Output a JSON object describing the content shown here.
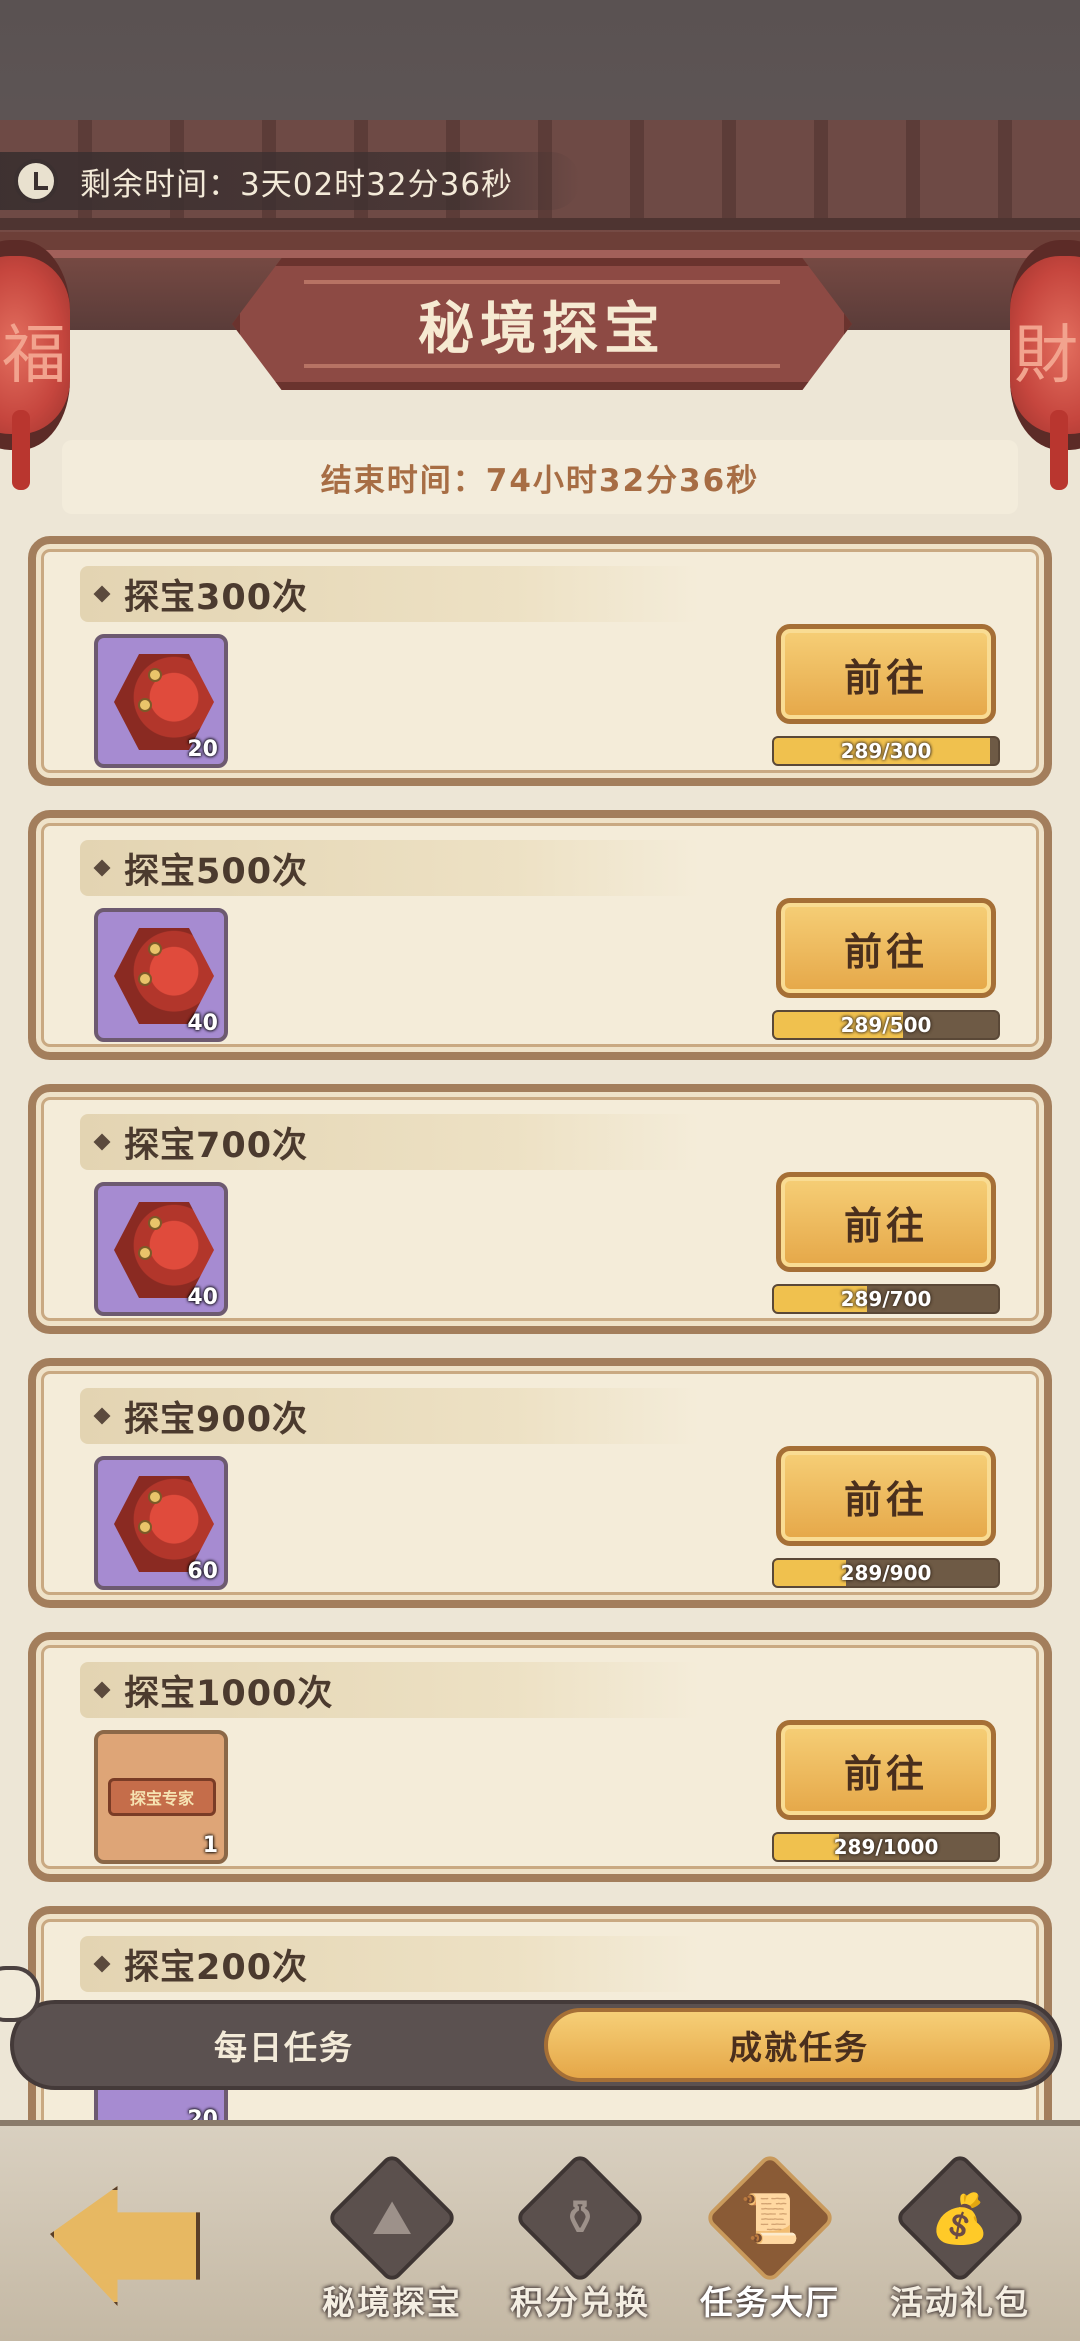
{
  "timer": {
    "label": "剩余时间：3天02时32分36秒"
  },
  "lanterns": {
    "left_glyph": "福",
    "right_glyph": "財"
  },
  "title": "秘境探宝",
  "end_time": "结束时间：74小时32分36秒",
  "tasks": [
    {
      "title": "探宝300次",
      "reward_count": "20",
      "reward_type": "purple-gem",
      "button": "前往",
      "progress_text": "289/300",
      "progress": 0.963
    },
    {
      "title": "探宝500次",
      "reward_count": "40",
      "reward_type": "purple-gem",
      "button": "前往",
      "progress_text": "289/500",
      "progress": 0.578
    },
    {
      "title": "探宝700次",
      "reward_count": "40",
      "reward_type": "purple-gem",
      "button": "前往",
      "progress_text": "289/700",
      "progress": 0.413
    },
    {
      "title": "探宝900次",
      "reward_count": "60",
      "reward_type": "purple-gem",
      "button": "前往",
      "progress_text": "289/900",
      "progress": 0.321
    },
    {
      "title": "探宝1000次",
      "reward_count": "1",
      "reward_type": "title-scroll",
      "reward_label": "探宝专家",
      "button": "前往",
      "progress_text": "289/1000",
      "progress": 0.289
    },
    {
      "title": "探宝200次",
      "reward_count": "20",
      "reward_type": "purple-gem"
    }
  ],
  "tabs": {
    "daily": "每日任务",
    "achievement": "成就任务",
    "active": "achievement"
  },
  "nav": [
    {
      "label": "秘境探宝",
      "icon": "mountain-icon",
      "glyph": "⛰"
    },
    {
      "label": "积分兑换",
      "icon": "pot-icon",
      "glyph": "⚱"
    },
    {
      "label": "任务大厅",
      "icon": "scroll-icon",
      "glyph": "📜",
      "active": true
    },
    {
      "label": "活动礼包",
      "icon": "gift-bag-icon",
      "glyph": "💰"
    }
  ],
  "colors": {
    "accent": "#e5a748",
    "panel": "#f4ecd9",
    "border": "#a37e5c",
    "progress_fill": "#f0c14e"
  }
}
